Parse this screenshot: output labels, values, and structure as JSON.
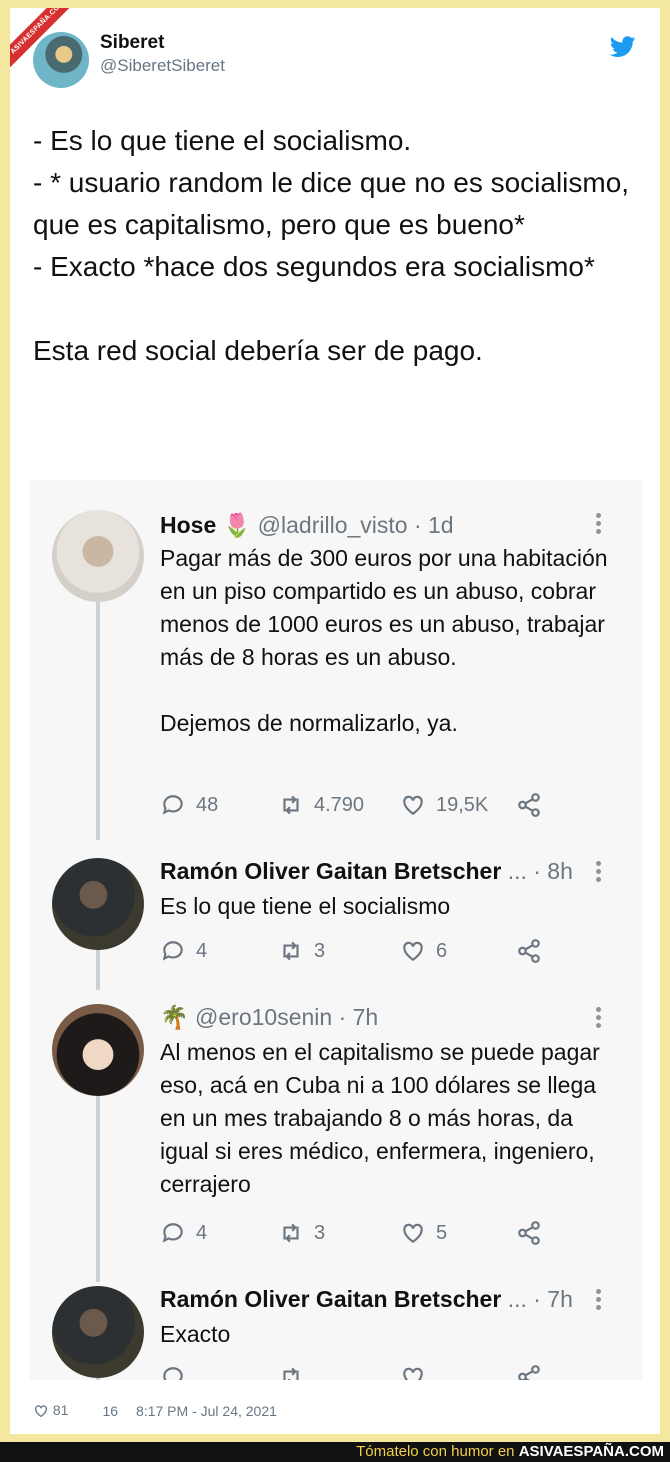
{
  "watermark": {
    "ribbon": "ASIVAESPAÑA.COM",
    "tagline": "Tómatelo con humor en",
    "site": "ASIVAESPAÑA.COM"
  },
  "author": {
    "name": "Siberet",
    "handle": "@SiberetSiberet"
  },
  "icons": {
    "platform": "twitter-bird-icon",
    "reply": "reply-icon",
    "retweet": "retweet-icon",
    "like": "heart-icon",
    "share": "share-icon",
    "more": "more-dots-icon"
  },
  "colors": {
    "twitter_blue": "#1d9bf0",
    "background": "#f4e7a0",
    "ribbon": "#d6302f"
  },
  "tweet": {
    "text": "- Es lo que tiene el socialismo.\n- * usuario random le dice que no es socialismo,  que es capitalismo, pero que es bueno*\n- Exacto *hace dos segundos era socialismo*\n\nEsta red social debería ser de pago."
  },
  "embedded": {
    "replies": [
      {
        "name": "Hose",
        "emoji": "🌷",
        "handle": "@ladrillo_visto",
        "time": "· 1d",
        "body": "Pagar más de 300 euros por una habitación en un piso compartido es un abuso, cobrar menos de 1000 euros es un abuso, trabajar más de 8 horas es un abuso.\n\nDejemos de normalizarlo, ya.",
        "replies": "48",
        "retweets": "4.790",
        "likes": "19,5K"
      },
      {
        "name": "Ramón Oliver Gaitan Bretscher",
        "handle": "...",
        "time": "· 8h",
        "body": "Es lo que tiene el socialismo",
        "replies": "4",
        "retweets": "3",
        "likes": "6"
      },
      {
        "name": "",
        "emoji": "🌴",
        "handle": "@ero10senin",
        "time": "· 7h",
        "body": "Al menos en el capitalismo se puede pagar eso, acá en Cuba ni a 100 dólares se llega en un mes trabajando 8 o más horas, da igual si eres médico, enfermera, ingeniero, cerrajero",
        "replies": "4",
        "retweets": "3",
        "likes": "5"
      },
      {
        "name": "Ramón Oliver Gaitan Bretscher",
        "handle": "...",
        "time": "· 7h",
        "body": "Exacto",
        "replies": "",
        "retweets": "",
        "likes": ""
      }
    ]
  },
  "footer": {
    "likes": "81",
    "comments": "16",
    "timestamp": "8:17 PM - Jul 24, 2021"
  }
}
